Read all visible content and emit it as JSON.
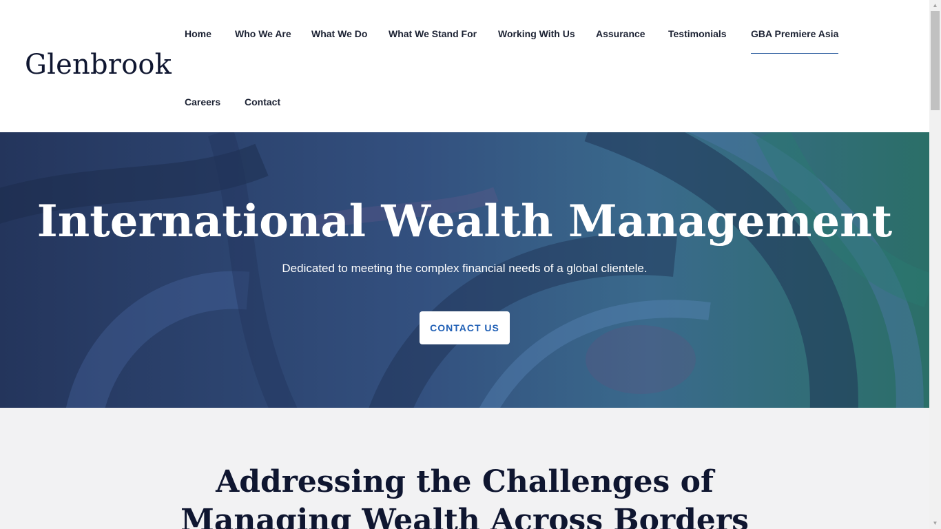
{
  "header": {
    "logo": "Glenbrook",
    "nav": [
      {
        "label": "Home"
      },
      {
        "label": "Who We Are"
      },
      {
        "label": "What We Do"
      },
      {
        "label": "What We Stand For"
      },
      {
        "label": "Working With Us"
      },
      {
        "label": "Assurance"
      },
      {
        "label": "Testimonials"
      },
      {
        "label": "GBA Premiere Asia",
        "active": true
      },
      {
        "label": "Careers"
      },
      {
        "label": "Contact"
      }
    ]
  },
  "hero": {
    "title": "International Wealth Management",
    "subtitle": "Dedicated to meeting the complex financial needs of a global clientele.",
    "button_label": "CONTACT US"
  },
  "section": {
    "title_line1": "Addressing the Challenges of",
    "title_line2": "Managing Wealth Across Borders"
  },
  "colors": {
    "accent": "#1f5fb5",
    "heading": "#0f1630",
    "hero_blue": "#2d4677",
    "hero_teal": "#2c6e6a",
    "section_bg": "#f2f2f3"
  },
  "icons": {
    "scroll_up": "triangle-up-icon",
    "scroll_down": "triangle-down-icon"
  }
}
